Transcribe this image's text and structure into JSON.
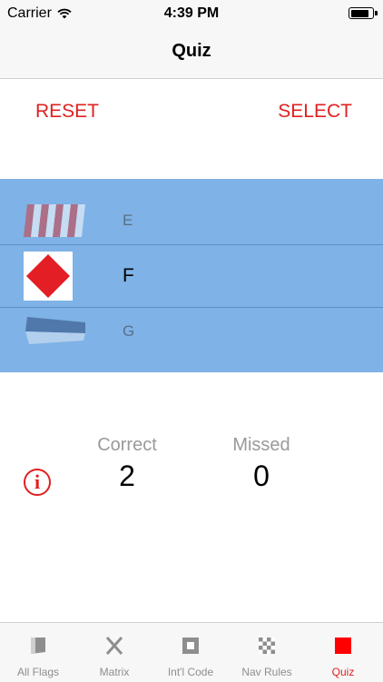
{
  "status_bar": {
    "carrier": "Carrier",
    "time": "4:39 PM",
    "battery_level": 0.9
  },
  "nav": {
    "title": "Quiz"
  },
  "actions": {
    "reset_label": "RESET",
    "select_label": "SELECT"
  },
  "picker": {
    "rows": [
      {
        "label": "E",
        "flag_icon": "flag-e-icon"
      },
      {
        "label": "F",
        "flag_icon": "flag-f-icon",
        "selected": true
      },
      {
        "label": "G",
        "flag_icon": "flag-g-icon"
      }
    ]
  },
  "score": {
    "correct_label": "Correct",
    "correct_value": "2",
    "missed_label": "Missed",
    "missed_value": "0"
  },
  "info": {
    "glyph": "i"
  },
  "colors": {
    "accent": "#e02020",
    "picker_bg": "#7fb2e6"
  },
  "tabs": [
    {
      "label": "All Flags",
      "icon": "all-flags-icon"
    },
    {
      "label": "Matrix",
      "icon": "matrix-icon"
    },
    {
      "label": "Int'l Code",
      "icon": "intl-code-icon"
    },
    {
      "label": "Nav Rules",
      "icon": "nav-rules-icon"
    },
    {
      "label": "Quiz",
      "icon": "quiz-icon",
      "active": true
    }
  ]
}
